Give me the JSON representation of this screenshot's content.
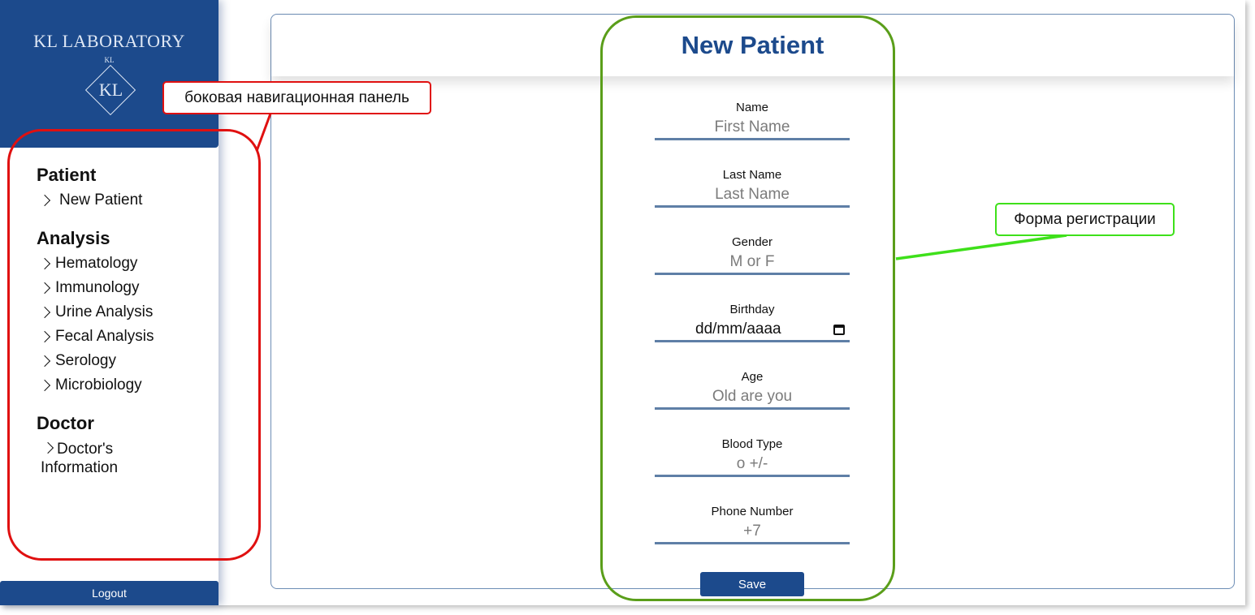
{
  "sidebar": {
    "brand_title": "KL LABORATORY",
    "brand_mark": "KL",
    "brand_logo_text": "KL",
    "sections": [
      {
        "title": "Patient",
        "items": [
          {
            "label": "New Patient"
          }
        ]
      },
      {
        "title": "Analysis",
        "items": [
          {
            "label": "Hematology"
          },
          {
            "label": "Immunology"
          },
          {
            "label": "Urine Analysis"
          },
          {
            "label": "Fecal Analysis"
          },
          {
            "label": "Serology"
          },
          {
            "label": "Microbiology"
          }
        ]
      },
      {
        "title": "Doctor",
        "items": [
          {
            "label": "Doctor's",
            "label2": "Information"
          }
        ]
      }
    ],
    "logout_label": "Logout"
  },
  "form": {
    "title": "New Patient",
    "fields": [
      {
        "label": "Name",
        "placeholder": "First Name"
      },
      {
        "label": "Last Name",
        "placeholder": "Last Name"
      },
      {
        "label": "Gender",
        "placeholder": "M or F"
      },
      {
        "label": "Birthday",
        "value": "dd/mm/aaaa",
        "icon": "calendar-icon"
      },
      {
        "label": "Age",
        "placeholder": "Old are you"
      },
      {
        "label": "Blood Type",
        "placeholder": "o +/-"
      },
      {
        "label": "Phone Number",
        "placeholder": "+7"
      }
    ],
    "save_label": "Save"
  },
  "annotations": {
    "sidebar_note": "боковая навигационная панель",
    "form_note": "Форма регистрации"
  },
  "colors": {
    "brand": "#1c4a8c",
    "field_underline": "#5f7fa6",
    "annotation_red": "#e01010",
    "annotation_green": "#3ee01a"
  }
}
